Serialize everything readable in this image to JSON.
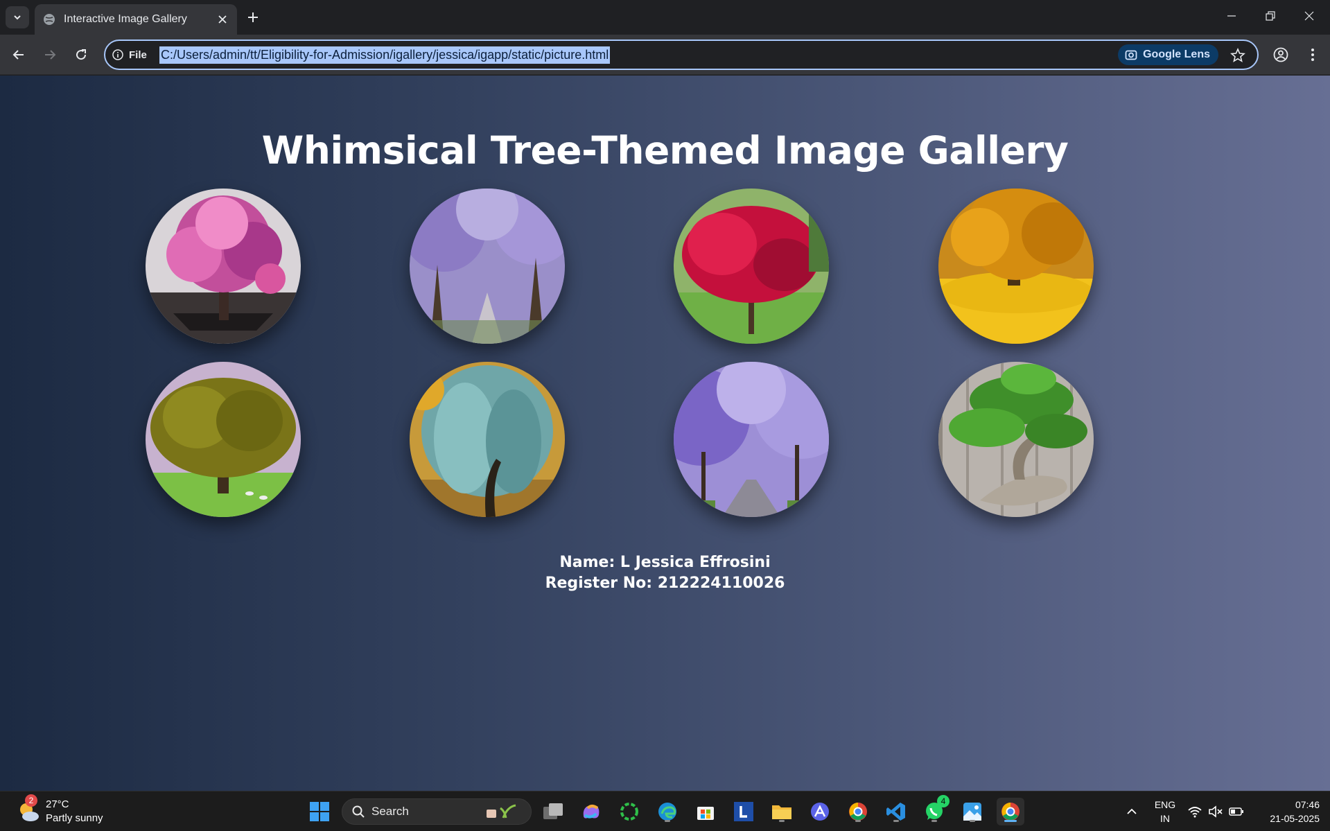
{
  "browser": {
    "tab_title": "Interactive Image Gallery",
    "omnibox_chip": "File",
    "url": "C:/Users/admin/tt/Eligibility-for-Admission/igallery/jessica/igapp/static/picture.html",
    "lens_label": "Google Lens"
  },
  "page": {
    "heading": "Whimsical Tree-Themed Image Gallery",
    "images": [
      {
        "subject": "pink blossom tree"
      },
      {
        "subject": "lavender jacaranda avenue"
      },
      {
        "subject": "red japanese maple"
      },
      {
        "subject": "golden ginkgo tree"
      },
      {
        "subject": "green oak in meadow"
      },
      {
        "subject": "blue weeping willow"
      },
      {
        "subject": "purple jacaranda road"
      },
      {
        "subject": "bonsai tree by fence"
      }
    ],
    "name_line": "Name: L Jessica Effrosini",
    "register_line": "Register No: 212224110026"
  },
  "taskbar": {
    "weather_temp": "27°C",
    "weather_desc": "Partly sunny",
    "weather_badge": "2",
    "search_label": "Search",
    "whatsapp_badge": "4",
    "lang_line1": "ENG",
    "lang_line2": "IN",
    "time": "07:46",
    "date": "21-05-2025"
  },
  "colors": {
    "accent": "#a8c7fa",
    "page_gradient_start": "#1c2a42",
    "page_gradient_end": "#676f94"
  }
}
